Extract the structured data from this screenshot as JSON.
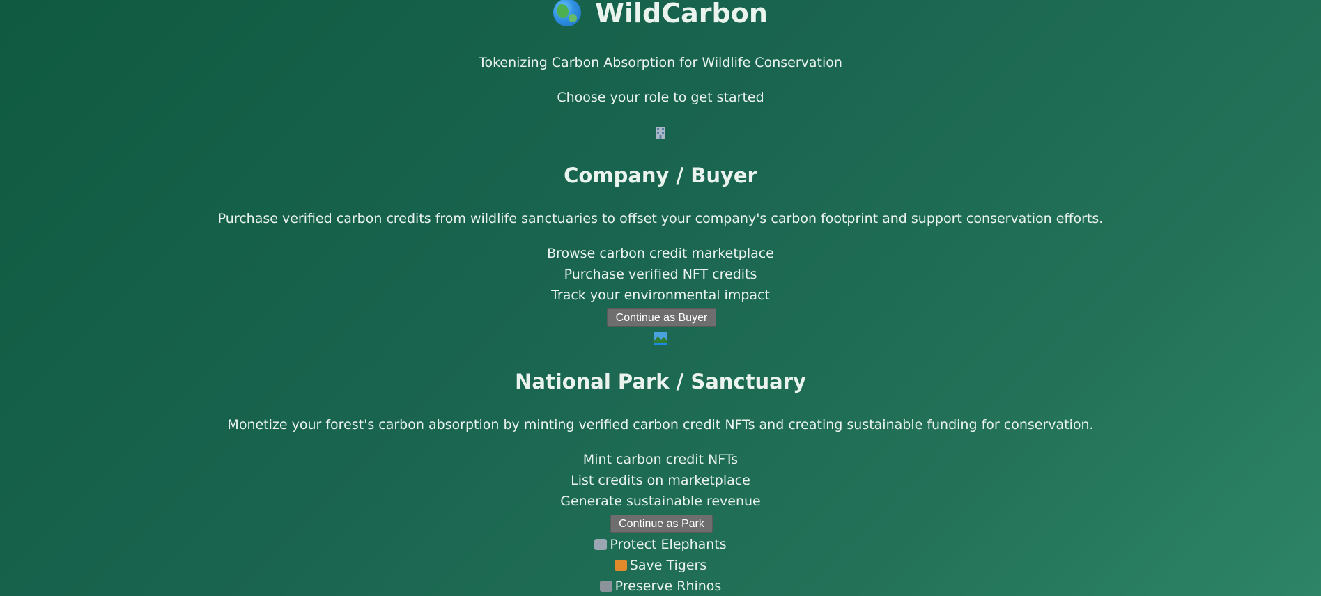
{
  "header": {
    "title": "WildCarbon",
    "tagline": "Tokenizing Carbon Absorption for Wildlife Conservation",
    "prompt": "Choose your role to get started"
  },
  "roles": [
    {
      "icon": "office-building-icon",
      "title": "Company / Buyer",
      "description": "Purchase verified carbon credits from wildlife sanctuaries to offset your company's carbon footprint and support conservation efforts.",
      "features": [
        "Browse carbon credit marketplace",
        "Purchase verified NFT credits",
        "Track your environmental impact"
      ],
      "button": "Continue as Buyer"
    },
    {
      "icon": "national-park-icon",
      "title": "National Park / Sanctuary",
      "description": "Monetize your forest's carbon absorption by minting verified carbon credit NFTs and creating sustainable funding for conservation.",
      "features": [
        "Mint carbon credit NFTs",
        "List credits on marketplace",
        "Generate sustainable revenue"
      ],
      "button": "Continue as Park"
    }
  ],
  "causes": [
    {
      "icon": "elephant-icon",
      "label": "Protect Elephants"
    },
    {
      "icon": "tiger-icon",
      "label": "Save Tigers"
    },
    {
      "icon": "rhino-icon",
      "label": "Preserve Rhinos"
    }
  ],
  "colors": {
    "background_start": "#0f5a40",
    "background_end": "#2d8466",
    "text": "#eaf3ee",
    "button": "#6e6e6e"
  }
}
